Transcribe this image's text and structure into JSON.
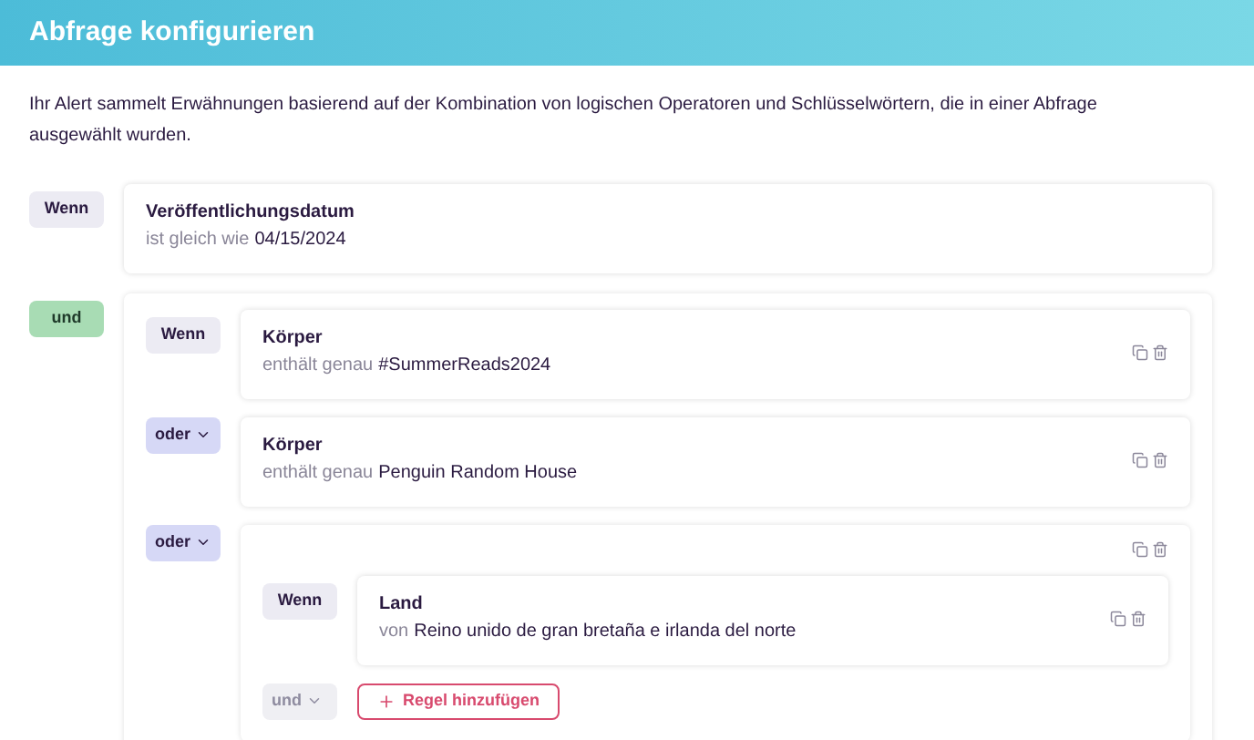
{
  "header": {
    "title": "Abfrage konfigurieren"
  },
  "description": "Ihr Alert sammelt Erwähnungen basierend auf der Kombination von logischen Operatoren und Schlüsselwörtern, die in einer Abfrage ausgewählt wurden.",
  "rules": [
    {
      "operator": {
        "label": "Wenn",
        "kind": "plain"
      },
      "kind": "condition",
      "field": "Veröffentlichungsdatum",
      "comparison": "ist gleich wie",
      "value": "04/15/2024",
      "actions": false
    },
    {
      "operator": {
        "label": "und",
        "kind": "and"
      },
      "kind": "group",
      "actions": false,
      "children": [
        {
          "operator": {
            "label": "Wenn",
            "kind": "plain"
          },
          "kind": "condition",
          "field": "Körper",
          "comparison": "enthält genau",
          "value": "#SummerReads2024",
          "actions": true
        },
        {
          "operator": {
            "label": "oder",
            "kind": "dropdown",
            "disabled": false
          },
          "kind": "condition",
          "field": "Körper",
          "comparison": "enthält genau",
          "value": "Penguin Random House",
          "actions": true
        },
        {
          "operator": {
            "label": "oder",
            "kind": "dropdown",
            "disabled": false
          },
          "kind": "group",
          "actions": true,
          "children": [
            {
              "operator": {
                "label": "Wenn",
                "kind": "plain"
              },
              "kind": "condition",
              "field": "Land",
              "comparison": "von",
              "value": "Reino unido de gran bretaña e irlanda del norte",
              "actions": true
            }
          ],
          "footer": {
            "operator": {
              "label": "und",
              "kind": "dropdown",
              "disabled": true
            },
            "add_button": "Regel hinzufügen"
          }
        }
      ]
    }
  ]
}
